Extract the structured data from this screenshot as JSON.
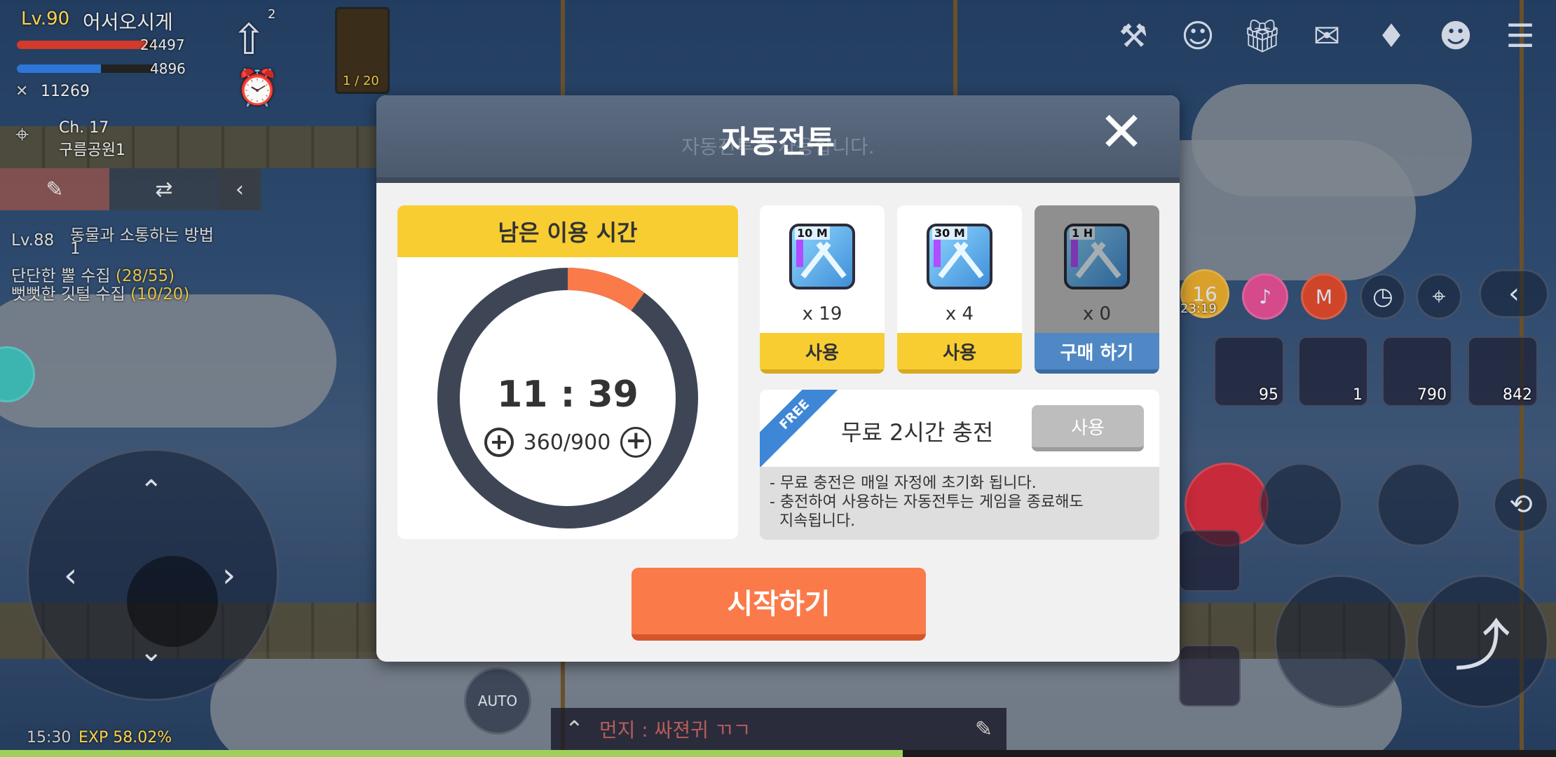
{
  "player": {
    "level": "Lv.90",
    "name": "어서오시게",
    "hp": "24497",
    "mp": "4896",
    "power": "11269",
    "channel": "Ch. 17",
    "map": "구름공원1",
    "party_count": "2",
    "pet_count": "1 / 20"
  },
  "quest": {
    "level": "Lv.88",
    "title_line1": "동물과 소통하는 방법",
    "title_line2": "1",
    "task1_text": "단단한 뿔 수집 ",
    "task1_progress": "(28/55)",
    "task2_text": "뻣뻣한 깃털 수집 ",
    "task2_progress": "(10/20)"
  },
  "hud": {
    "buff_timer": "23:19",
    "slots": [
      {
        "count": "95"
      },
      {
        "count": "1"
      },
      {
        "count": "790"
      },
      {
        "count": "842"
      }
    ],
    "auto_label": "AUTO",
    "time": "15:30",
    "exp": "EXP 58.02%",
    "exp_fraction": 0.5802,
    "chat_text": "먼지 : 싸젼귀 ㄲㄱ"
  },
  "dialog": {
    "title": "자동전투",
    "subtitle_ghost": "자동전투를 사용합니다.",
    "close_glyph": "✕",
    "remaining": {
      "header": "남은 이용 시간",
      "time": "11 : 39",
      "energy": "360/900",
      "plus": "+",
      "fraction_used": 0.1
    },
    "tickets": [
      {
        "tag": "10 M",
        "count": "x 19",
        "button": "사용"
      },
      {
        "tag": "30 M",
        "count": "x 4",
        "button": "사용"
      },
      {
        "tag": "1 H",
        "count": "x 0",
        "button": "구매 하기"
      }
    ],
    "free": {
      "ribbon": "FREE",
      "label": "무료 2시간 충전",
      "button": "사용"
    },
    "notes": [
      "- 무료 충전은 매일 자정에 초기화 됩니다.",
      "- 충전하여 사용하는 자동전투는 게임을 종료해도",
      "  지속됩니다."
    ],
    "start": "시작하기"
  },
  "colors": {
    "accent_yellow": "#f7cd32",
    "start_orange": "#fb7a4a",
    "ring_dark": "#3e4655",
    "ring_progress": "#fb7a4a",
    "buy_blue": "#4f88c4"
  }
}
